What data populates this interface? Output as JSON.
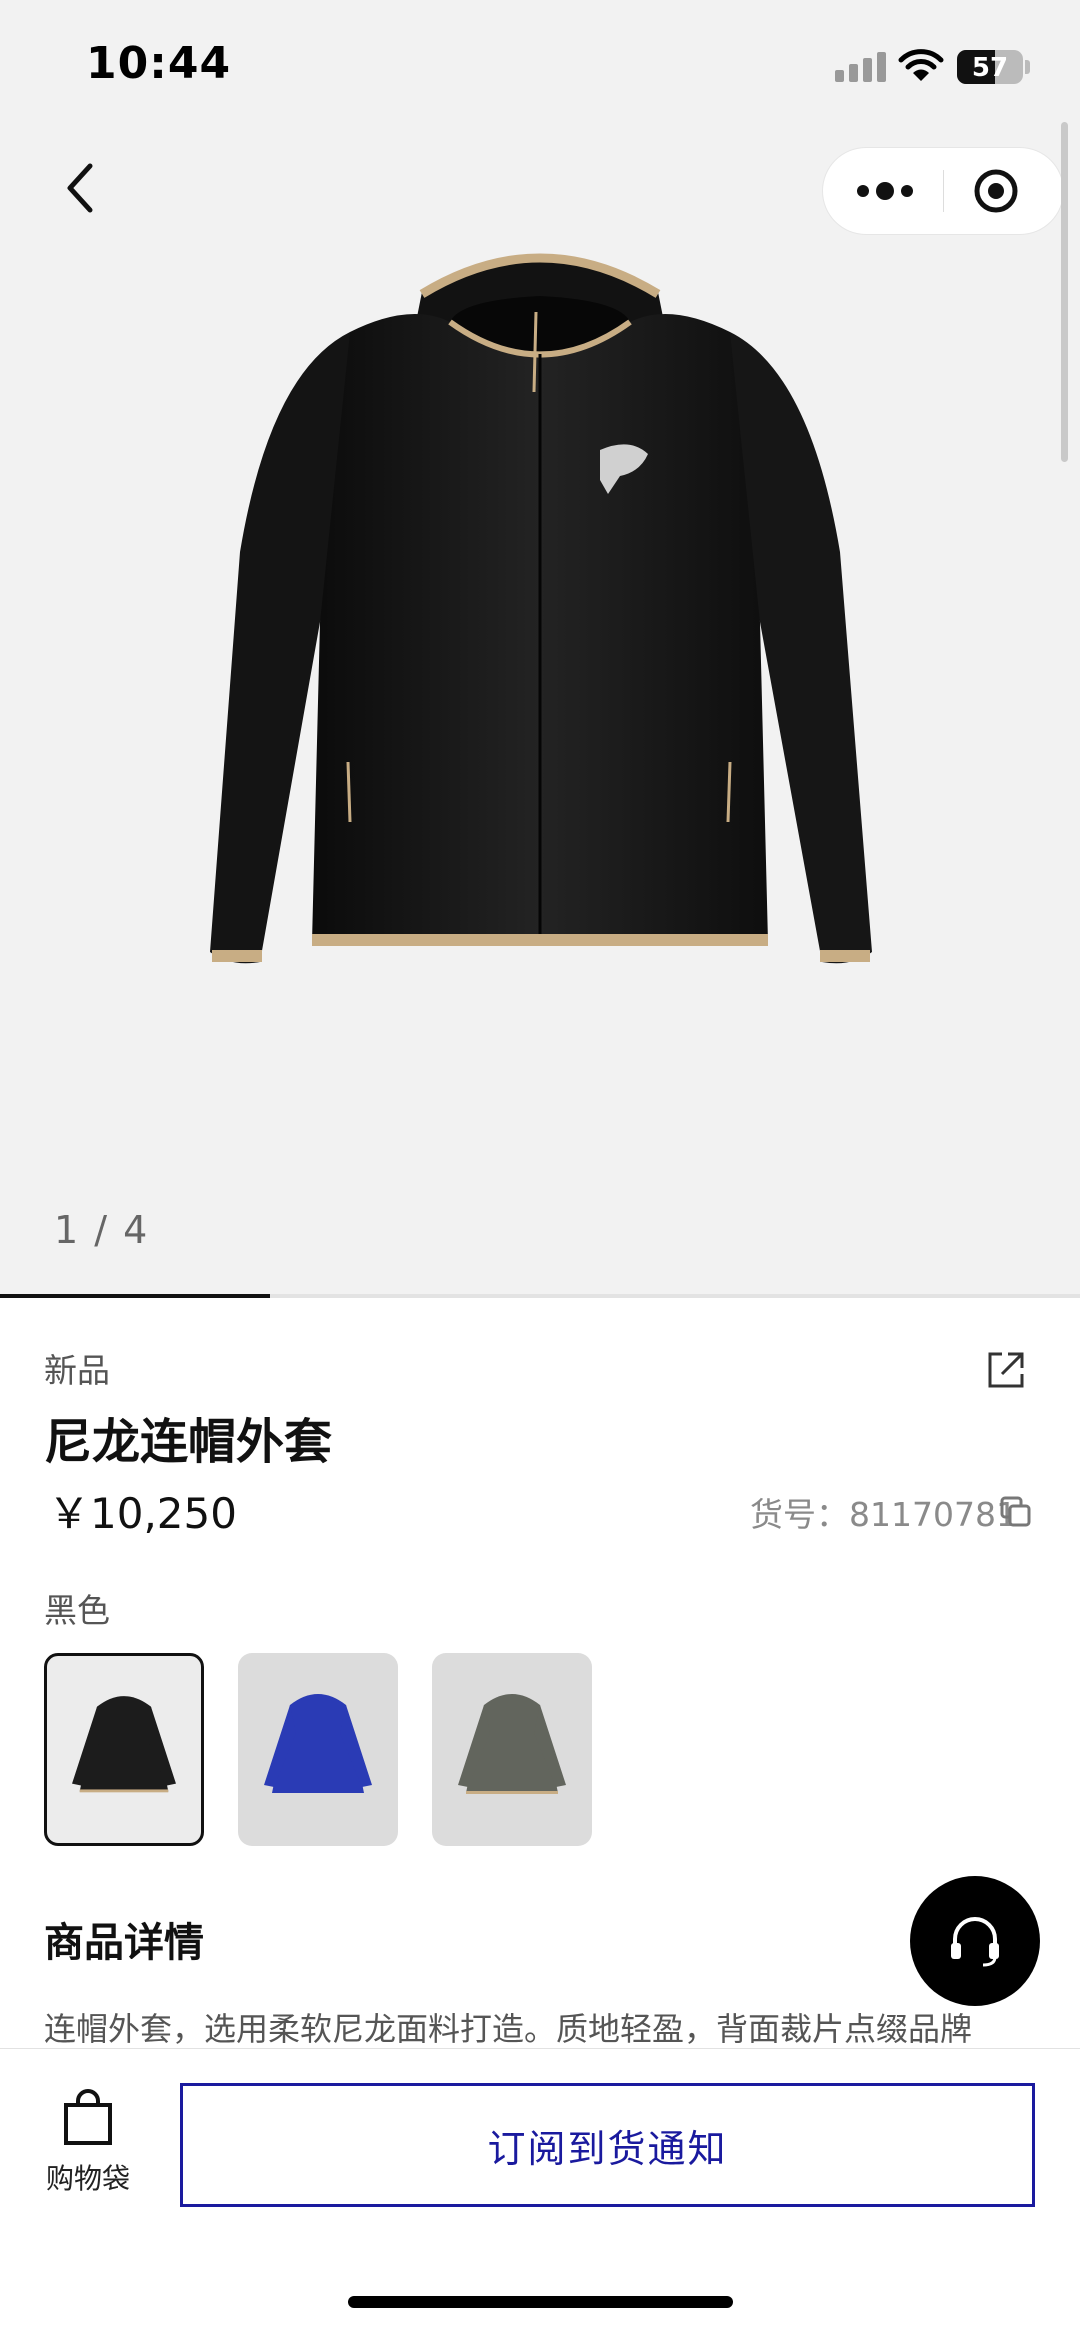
{
  "status_bar": {
    "time": "10:44",
    "battery_percent": "57"
  },
  "gallery": {
    "counter": "1 / 4",
    "current": 1,
    "total": 4,
    "progress_fraction": 0.25
  },
  "product": {
    "tag": "新品",
    "title": "尼龙连帽外套",
    "price": "￥10,250",
    "sku_label": "货号：",
    "sku": "81170781",
    "color_label": "黑色",
    "swatches": [
      {
        "name": "black",
        "color": "#1c1c1c",
        "selected": true
      },
      {
        "name": "blue",
        "color": "#2a3bb5",
        "selected": false
      },
      {
        "name": "grey",
        "color": "#62655d",
        "selected": false
      }
    ]
  },
  "details": {
    "section_title": "商品详情",
    "description": "连帽外套，选用柔软尼龙面料打造。质地轻盈，背面裁片点缀品牌"
  },
  "bottom_bar": {
    "bag_label": "购物袋",
    "notify_label": "订阅到货通知"
  },
  "colors": {
    "accent": "#1a1a9e",
    "hero_bg": "#f2f2f2",
    "trim": "#c8ad84"
  },
  "icons": [
    "back-icon",
    "more-dots-icon",
    "target-icon",
    "share-icon",
    "copy-icon",
    "headset-icon",
    "shopping-bag-icon"
  ]
}
